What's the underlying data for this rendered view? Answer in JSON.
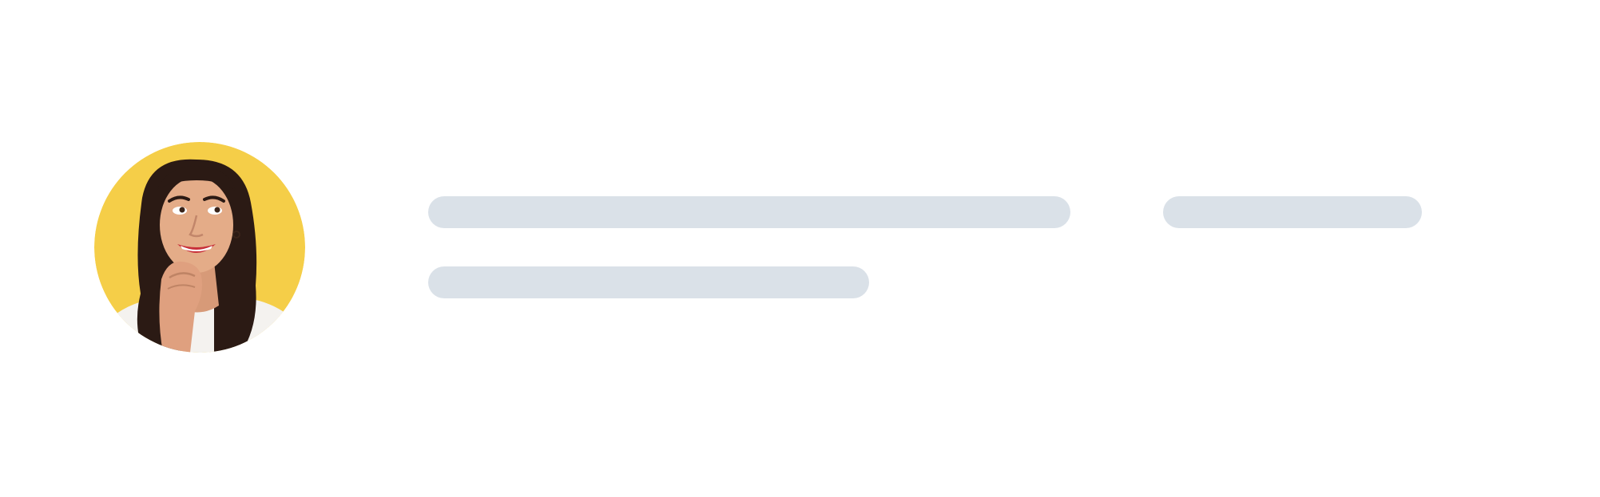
{
  "card": {
    "avatar": {
      "icon": "user-photo-avatar",
      "background_color": "#F5CE48"
    },
    "skeleton": {
      "color": "#DAE1E8",
      "lines": [
        "primary-text-placeholder",
        "secondary-text-placeholder",
        "meta-text-placeholder"
      ]
    }
  }
}
